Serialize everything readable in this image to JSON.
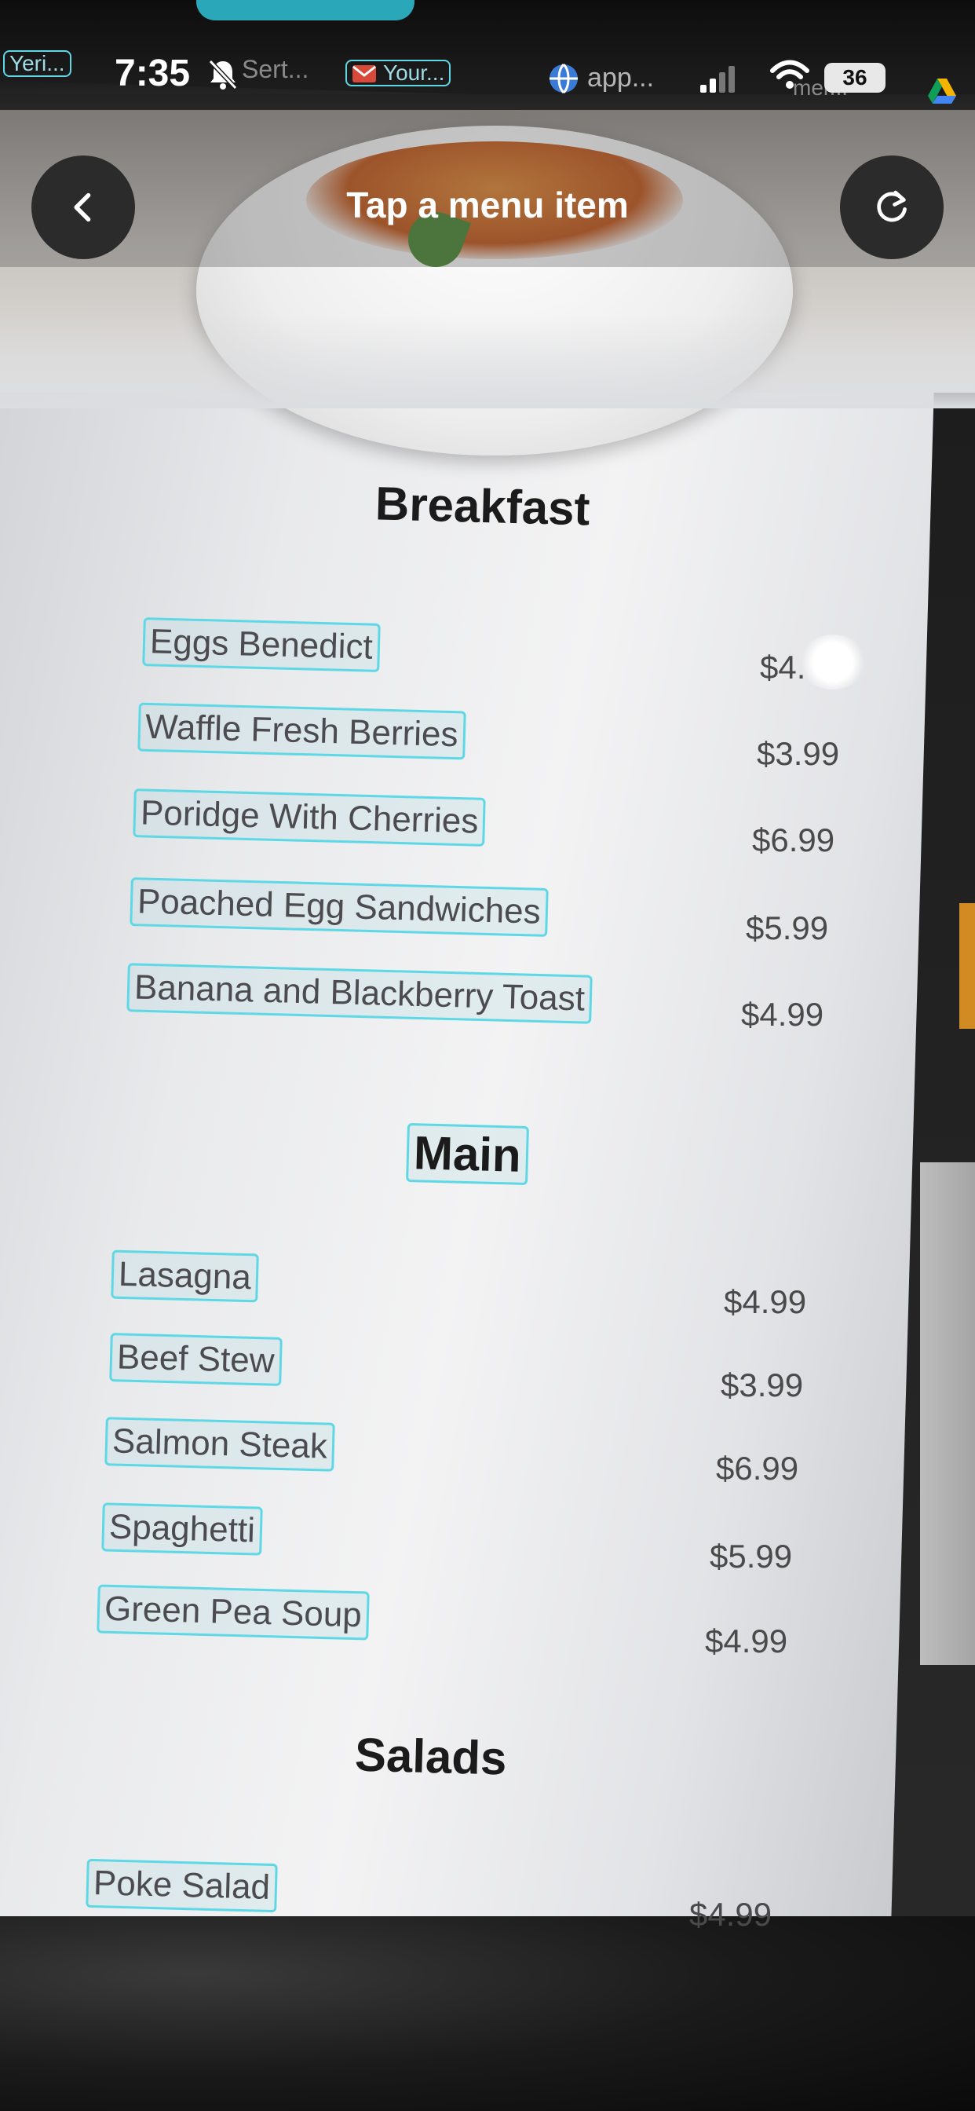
{
  "status_bar": {
    "back_app_label": "Yeri...",
    "time": "7:35",
    "faint_notification": "Sert...",
    "mail_label": "Your...",
    "app_label": "app...",
    "faint_behind_wifi": "mer...",
    "battery": "36",
    "icons": [
      "bell-slash-icon",
      "mail-icon",
      "globe-icon",
      "signal-icon",
      "wifi-icon",
      "battery-icon",
      "drive-icon"
    ]
  },
  "header": {
    "title": "Tap a menu item",
    "back_icon": "chevron-left-icon",
    "refresh_icon": "refresh-icon"
  },
  "menu": {
    "breakfast": {
      "title": "Breakfast",
      "items": [
        {
          "name": "Eggs Benedict",
          "price": "$4."
        },
        {
          "name": "Waffle Fresh Berries",
          "price": "$3.99"
        },
        {
          "name": "Poridge With Cherries",
          "price": "$6.99"
        },
        {
          "name": "Poached Egg Sandwiches",
          "price": "$5.99"
        },
        {
          "name": "Banana and Blackberry Toast",
          "price": "$4.99"
        }
      ]
    },
    "main": {
      "title": "Main",
      "items": [
        {
          "name": "Lasagna",
          "price": "$4.99"
        },
        {
          "name": "Beef Stew",
          "price": "$3.99"
        },
        {
          "name": "Salmon Steak",
          "price": "$6.99"
        },
        {
          "name": "Spaghetti",
          "price": "$5.99"
        },
        {
          "name": "Green Pea Soup",
          "price": "$4.99"
        }
      ]
    },
    "salads": {
      "title": "Salads",
      "items": [
        {
          "name": "Poke Salad",
          "price": "$4.99"
        }
      ]
    }
  },
  "colors": {
    "highlight_border": "#5fd8e6",
    "header_text": "#ffffff",
    "button_bg": "#2b2b2b"
  }
}
